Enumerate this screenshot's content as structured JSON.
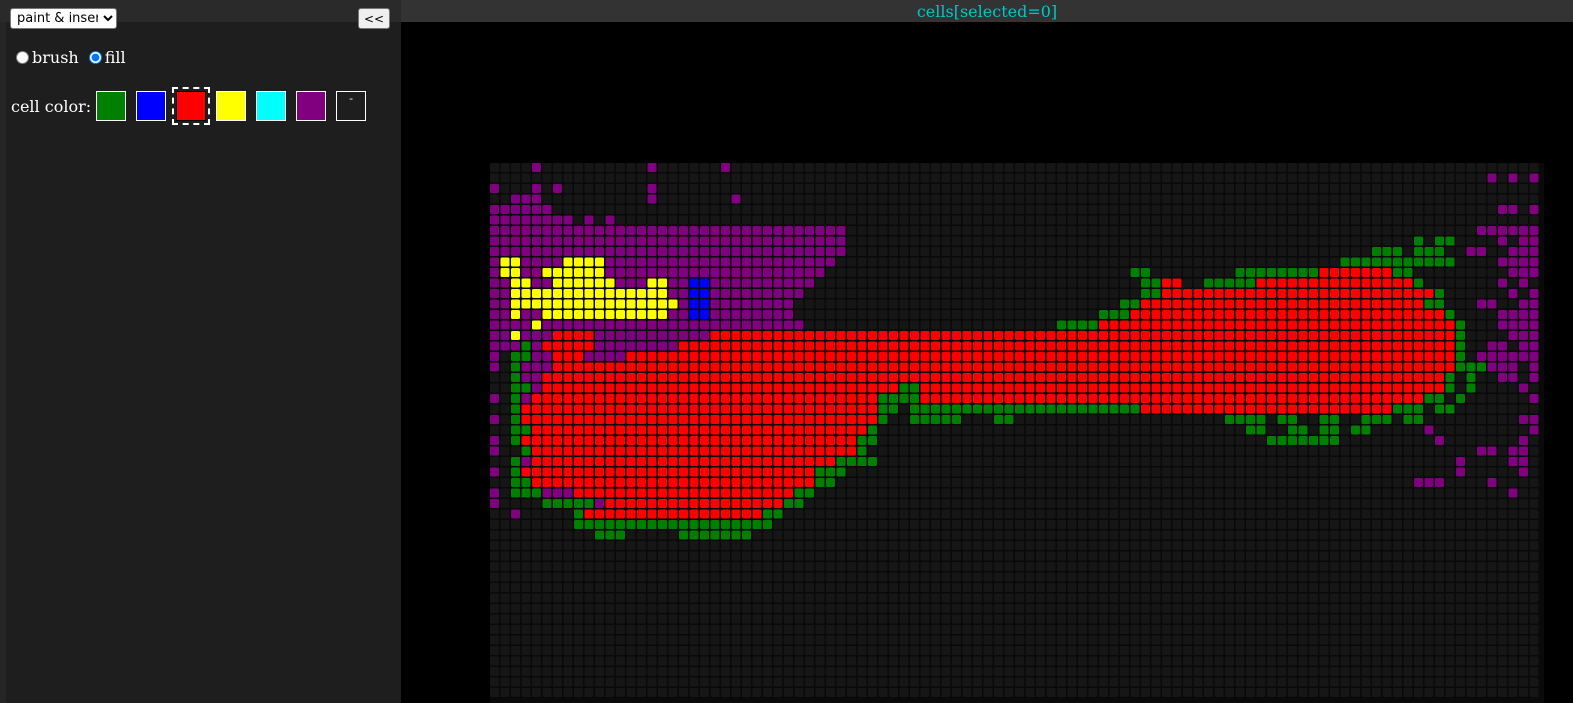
{
  "sidebar": {
    "mode_select": {
      "value": "paint & insert",
      "options": [
        "paint & insert"
      ]
    },
    "collapse_label": "<<",
    "tools": [
      {
        "label": "brush",
        "checked": false
      },
      {
        "label": "fill",
        "checked": true
      }
    ],
    "color_label": "cell color:",
    "colors": [
      {
        "name": "green",
        "hex": "#008000"
      },
      {
        "name": "blue",
        "hex": "#0000ff"
      },
      {
        "name": "red",
        "hex": "#ff0000",
        "selected": true
      },
      {
        "name": "yellow",
        "hex": "#ffff00"
      },
      {
        "name": "cyan",
        "hex": "#00ffff"
      },
      {
        "name": "purple",
        "hex": "#800080"
      },
      {
        "name": "empty",
        "hex": "#1e1e1e",
        "glyph": "-"
      }
    ]
  },
  "header": {
    "title": "cells[selected=0]"
  },
  "board": {
    "palette": {
      "g": "#008000",
      "b": "#0000ff",
      "r": "#ff0000",
      "y": "#ffff00",
      "p": "#800080",
      "empty": "#161616"
    },
    "rows": [
      "....p..........p......p..............................................................................",
      "...............................................................................................p.p.p..",
      "p...p.p........p.....................................................................................",
      "..ppp..........p.......p............................................................................pp",
      "pppppp..........................................................................................pp.p.ppp",
      "pppppppp.p.p...........................................................................................",
      "pppppppppppppppppppppppppppppppppp............................................................ppppppppp",
      "pppppppppppppppppppppppppppppppppp......................................................g.gg....p.pp.ppp",
      "pppppppppppppppppppppppppppppppppp..................................................ggg.ggg..pp..pppppp",
      "pyyppppyyyypppppppppppppppppppppp................................................ggggggggggg....pppp.pp",
      "pyyppyyyyyyppppppppppppppppppppp.............................gg........ggggggggrrrrrrrgg.........ppppp",
      "ppyyppyyyyyypppyyppbbpppppppppp...............................ggrr..gggggrrrrrrrrrrrrrrrg.......p.p.ppp",
      "ppyyyyyyyyyyyyyyyppbbppppppppp................................ggrrrrrrrrrrrrrrrrrrrrrrrrrrg......p.ppppp",
      "ppyyyyyyyyyyyyyyyypbbpppppppp...............................ggrrrrrrrrrrrrrrrrrrrrrrrrrrrgg...pp..pppp",
      "ppyppyyyyyyyyyyyyppbbpppppppp.............................gggrrrrrrrrrrrrrrrrrrrrrrrrrrrrrrg....pppppp.",
      "ppppyppppppppppppppppppppppppp........................ggggrrrrrrrrrrrrrrrrrrrrrrrrrrrrrrrrrrg...pppp.p",
      "ppyppprrrrppppppppppprrrrrrrrrrrrrrrrrrrrrrrrrrrrrrrrrrrrrrrrrrrrrrrrrrrrrrrrrrrrrrrrrrrrrrrg....ppp.p",
      "pppgprrrrrpppppppprrrrrrrrrrrrrrrrrrrrrrrrrrrrrrrrrrrrrrrrrrrrrrrrrrrrrrrrrrrrrrrrrrrrrrrrrrg..pp.ppp",
      "p.ggpprrrpppprrrrrrrrrrrrrrrrrrrrrrrrrrrrrrrrrrrrrrrrrrrrrrrrrrrrrrrrrrrrrrrrrrrrrrrrrrrrrrrg.pppppppp",
      "p.gppprrrrrrrrrrrrrrrrrrrrrrrrrrrrrrrrrrrrrrrrrrrrrrrrrrrrrrrrrrrrrrrrrrrrrrrrrrrrrrrrrrrrrrgggppp.p.",
      "..gpprrrrrrrrrrrrrrrrrrrrrrrrrrrrrrrrrrrrrrrrrrrrrrrrrrrrrrrrrrrrrrrrrrrrrrrrrrrrrrrrrrrrrrg.g..pp.pp",
      "..ggprrrrrrrrrrrrrrrrrrrrrrrrrrrrrrrrrrggrrrrrrrrrrrrrrrrrrrrrrrrrrrrrrrrrrrrrrrrrrrrrrrrrrg.g....p.pp",
      "p.gprrrrrrrrrrrrrrrrrrrrrrrrrrrrrrrrrggggrrrrrrrrrrrrrrrrrrrrrrrrrrrrrrrrrrrrrrrrrrrrrrrrgg.g......pp",
      "..grrrrrrrrrrrrrrrrrrrrrrrrrrrrrrrrrrgg.ggggggggggggggggggggggrrrrrrrrrrrrrrrrrrrrrrrrggg.gg........pp",
      "p.grrrrrrrrrrrrrrrrrrrrrrrrrrrrrrrrrrg..ggggg...gg....................gggg.gg..gg..ggg.gg.........pp",
      "..ggrrrrrrrrrrrrrrrrrrrrrrrrrrrrrrrrg...................................gg..gg.gg.gg.....p.........p",
      "p.grrrrrrrrrrrrrrrrrrrrrrrrrrrrrrrrgg.....................................ggggggg.........p.......p.",
      "p..grrrrrrrrrrrrrrrrrrrrrrrrrrrrrrrg..........................................................pp.pp",
      "..gprrrrrrrrrrrrrrrrrrrrrrrrrrrrrgggg.......................................................p....pp.",
      "p.grrrrrrrrrrrrrrrrrrrrrrrrrrrrggg..........................................................p.....p",
      "..ggrrrrrrrrrrrrrrrrrrrrrrrrrrrgg.......................................................ppp....p..",
      "p.gggppprrrrrrrrrrrrrrrrrrrrrgg..................................................................p",
      "p....gggggprrrrrrrrrrrrrrrrrgg......................................................................",
      "..p.....grrrrrrrrrrrrrrrrrgg.......................................................................",
      "........ggggggggggggggggggg........................................................................",
      "..........ggg.....ggggggg..........................................................................."
    ]
  }
}
